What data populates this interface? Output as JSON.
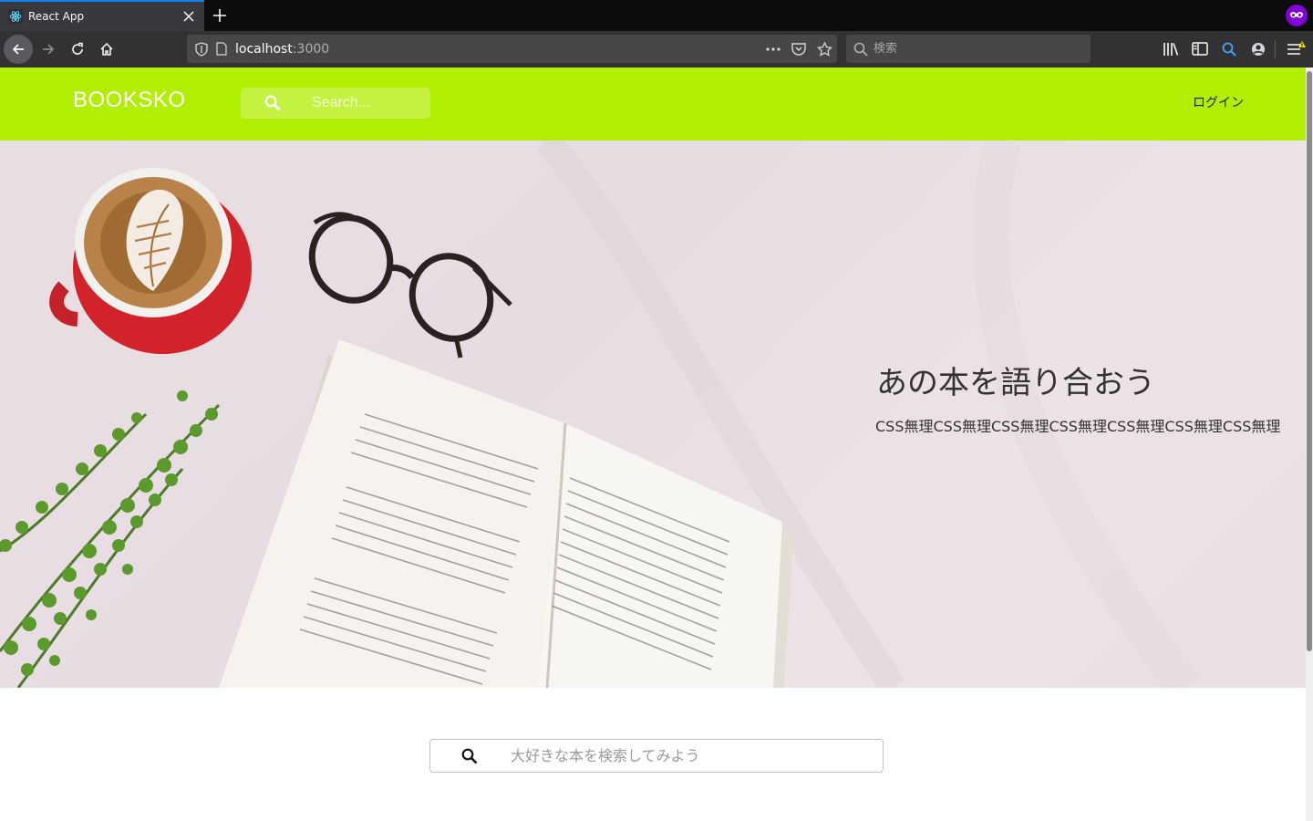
{
  "browser": {
    "tab_title": "React App",
    "url_host": "localhost",
    "url_port": ":3000",
    "search_placeholder": "検索",
    "icons": [
      "react-favicon",
      "close-icon",
      "plus-icon",
      "private-browsing-icon",
      "back-arrow-icon",
      "forward-arrow-icon",
      "reload-icon",
      "home-icon",
      "shield-icon",
      "page-icon",
      "more-icon",
      "pocket-icon",
      "bookmark-star-icon",
      "search-icon",
      "library-icon",
      "sidebar-icon",
      "account-icon",
      "menu-icon"
    ]
  },
  "header": {
    "brand": "BOOKSKO",
    "search_placeholder": "Search...",
    "login_label": "ログイン",
    "background": "#b1ee00"
  },
  "hero": {
    "title": "あの本を語り合おう",
    "subtitle": "CSS無理CSS無理CSS無理CSS無理CSS無理CSS無理CSS無理"
  },
  "main": {
    "search_placeholder": "大好きな本を検索してみよう"
  }
}
